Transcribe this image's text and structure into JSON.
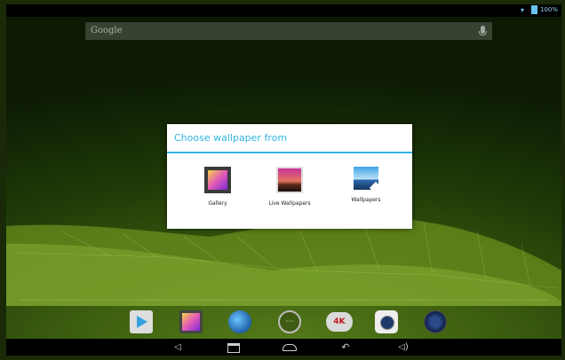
{
  "status_bar": {
    "battery_text": "100%"
  },
  "search": {
    "placeholder": "Google"
  },
  "dialog": {
    "title": "Choose wallpaper from",
    "options": [
      {
        "label": "Gallery",
        "icon": "gallery-icon"
      },
      {
        "label": "Live Wallpapers",
        "icon": "live-wallpapers-icon"
      },
      {
        "label": "Wallpapers",
        "icon": "wallpapers-icon"
      }
    ]
  },
  "dock": {
    "items": [
      {
        "icon": "play-store-icon"
      },
      {
        "icon": "gallery-icon"
      },
      {
        "icon": "browser-icon"
      },
      {
        "icon": "all-apps-icon"
      },
      {
        "icon": "4k-player-icon",
        "text": "4K"
      },
      {
        "icon": "camera-icon"
      },
      {
        "icon": "music-icon"
      }
    ]
  },
  "navbar": {
    "buttons": [
      "volume-down-icon",
      "recent-apps-icon",
      "home-icon",
      "back-icon",
      "volume-up-icon"
    ]
  },
  "colors": {
    "accent": "#33b5e5",
    "background": "#1f3a07",
    "dialog_bg": "#ffffff"
  }
}
